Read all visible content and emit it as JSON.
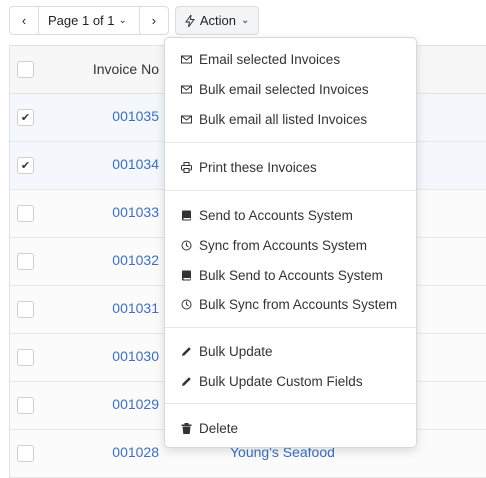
{
  "toolbar": {
    "prev_glyph": "‹",
    "page_label": "Page 1 of 1",
    "next_glyph": "›",
    "action_label": "Action"
  },
  "table": {
    "header": {
      "invoice_no": "Invoice No"
    },
    "rows": [
      {
        "invoice": "001035",
        "checked": true,
        "customer": ""
      },
      {
        "invoice": "001034",
        "checked": true,
        "customer": ""
      },
      {
        "invoice": "001033",
        "checked": false,
        "customer": ""
      },
      {
        "invoice": "001032",
        "checked": false,
        "customer": ""
      },
      {
        "invoice": "001031",
        "checked": false,
        "customer": ""
      },
      {
        "invoice": "001030",
        "checked": false,
        "customer": ""
      },
      {
        "invoice": "001029",
        "checked": false,
        "customer": ""
      },
      {
        "invoice": "001028",
        "checked": false,
        "customer": "Young's Seafood"
      }
    ]
  },
  "menu": {
    "email_selected": {
      "label": "Email selected Invoices",
      "icon": "envelope-icon"
    },
    "bulk_email_selected": {
      "label": "Bulk email selected Invoices",
      "icon": "envelope-icon"
    },
    "bulk_email_all": {
      "label": "Bulk email all listed Invoices",
      "icon": "envelope-icon"
    },
    "print": {
      "label": "Print these Invoices",
      "icon": "printer-icon"
    },
    "send_accounts": {
      "label": "Send to Accounts System",
      "icon": "book-icon"
    },
    "sync_accounts": {
      "label": "Sync from Accounts System",
      "icon": "sync-icon"
    },
    "bulk_send_accounts": {
      "label": "Bulk Send to Accounts System",
      "icon": "book-icon"
    },
    "bulk_sync_accounts": {
      "label": "Bulk Sync from Accounts System",
      "icon": "sync-icon"
    },
    "bulk_update": {
      "label": "Bulk Update",
      "icon": "pencil-icon"
    },
    "bulk_update_custom": {
      "label": "Bulk Update Custom Fields",
      "icon": "pencil-icon"
    },
    "delete": {
      "label": "Delete",
      "icon": "trash-icon"
    }
  },
  "colors": {
    "link": "#3a6fc9",
    "selected_row": "#f4f7fc"
  }
}
